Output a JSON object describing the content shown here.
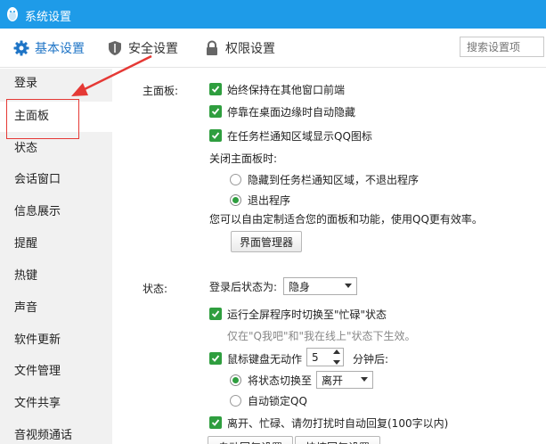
{
  "window": {
    "title": "系统设置"
  },
  "tabs": [
    {
      "label": "基本设置",
      "icon": "gear-icon",
      "active": true
    },
    {
      "label": "安全设置",
      "icon": "shield-icon"
    },
    {
      "label": "权限设置",
      "icon": "lock-icon"
    }
  ],
  "search": {
    "placeholder": "搜索设置项"
  },
  "sidebar": {
    "items": [
      {
        "label": "登录"
      },
      {
        "label": "主面板",
        "active": true
      },
      {
        "label": "状态"
      },
      {
        "label": "会话窗口"
      },
      {
        "label": "信息展示"
      },
      {
        "label": "提醒"
      },
      {
        "label": "热键"
      },
      {
        "label": "声音"
      },
      {
        "label": "软件更新"
      },
      {
        "label": "文件管理"
      },
      {
        "label": "文件共享"
      },
      {
        "label": "音视频通话"
      }
    ]
  },
  "main_panel": {
    "label": "主面板:",
    "always_on_top": {
      "label": "始终保持在其他窗口前端",
      "checked": true
    },
    "auto_hide": {
      "label": "停靠在桌面边缘时自动隐藏",
      "checked": true
    },
    "tray_icon": {
      "label": "在任务栏通知区域显示QQ图标",
      "checked": true
    },
    "close_label": "关闭主面板时:",
    "close_hide": {
      "label": "隐藏到任务栏通知区域，不退出程序",
      "selected": false
    },
    "close_exit": {
      "label": "退出程序",
      "selected": true
    },
    "custom_text": "您可以自由定制适合您的面板和功能，使用QQ更有效率。",
    "manager_button": "界面管理器"
  },
  "status": {
    "label": "状态:",
    "login_status_label": "登录后状态为:",
    "login_status_value": "隐身",
    "fullscreen_busy": {
      "label": "运行全屏程序时切换至\"忙碌\"状态",
      "checked": true
    },
    "fullscreen_hint": "仅在\"Q我吧\"和\"我在线上\"状态下生效。",
    "idle": {
      "label": "鼠标键盘无动作",
      "checked": true,
      "minutes": "5",
      "suffix": "分钟后:"
    },
    "switch_to": {
      "label": "将状态切换至",
      "selected": true,
      "value": "离开"
    },
    "auto_lock": {
      "label": "自动锁定QQ",
      "selected": false
    },
    "auto_reply": {
      "label": "离开、忙碌、请勿打扰时自动回复(100字以内)",
      "checked": true
    },
    "reply_settings_button": "自动回复设置",
    "quick_reply_button": "快捷回复设置"
  },
  "colors": {
    "titlebar": "#1e9be8",
    "accent": "#1e74c6",
    "checkbox": "#2f9e3f",
    "annotation": "#e53935"
  }
}
